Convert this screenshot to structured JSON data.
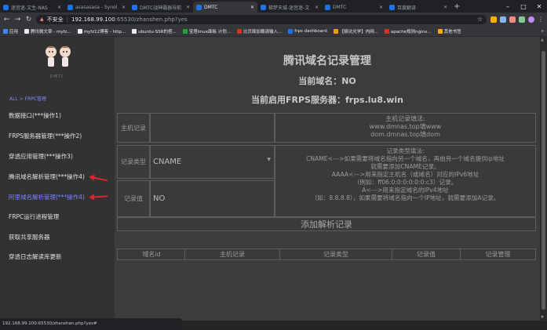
{
  "browser": {
    "tabs": [
      {
        "title": "迷宫迷-文生-NAS",
        "color": "#1a73e8",
        "active": false
      },
      {
        "title": "asasasasa - Synol",
        "color": "#1a73e8",
        "active": false
      },
      {
        "title": "DMTC战神霸器导航",
        "color": "#1a73e8",
        "active": false
      },
      {
        "title": "DMTC",
        "color": "#1a73e8",
        "active": true
      },
      {
        "title": "梯梦天城-迷宫迷-文",
        "color": "#1a73e8",
        "active": false
      },
      {
        "title": "DMTC",
        "color": "#1a73e8",
        "active": false
      },
      {
        "title": "百度翻译",
        "color": "#1a73e8",
        "active": false
      }
    ],
    "new_tab": "+",
    "window_controls": {
      "minimize": "–",
      "maximize": "□",
      "close": "✕"
    },
    "address": {
      "security": "不安全",
      "host": "192.168.99.100",
      "path": ":65530/zhanshen.php?yes"
    },
    "bookmarks": [
      {
        "label": "应用",
        "color": "#4285f4"
      },
      {
        "label": "腾讯微文章 - myfz...",
        "color": "#e8eaed"
      },
      {
        "label": "myfz12博客 - http...",
        "color": "#e8eaed"
      },
      {
        "label": "ubuntu-SSR的搭...",
        "color": "#e8eaed"
      },
      {
        "label": "宝塔linux面板 计划...",
        "color": "#20a53a"
      },
      {
        "label": "比页面加载请输入...",
        "color": "#d93025"
      },
      {
        "label": "frps dashboard",
        "color": "#1a73e8"
      },
      {
        "label": "【极坑光学】内网...",
        "color": "#f29900"
      },
      {
        "label": "apache规则nginx...",
        "color": "#d93025"
      },
      {
        "label": "其他书签",
        "color": "#f9ab00"
      }
    ],
    "bookmarks_more": "»",
    "status_url": "192.168.99.100:65530/zhanshen.php?yes#"
  },
  "sidebar": {
    "logo_text": "DMTC",
    "breadcrumb": "ALL  >  FRPC管理",
    "items": [
      {
        "label": "数据接口(***操作1)",
        "selected": false
      },
      {
        "label": "FRPS服务器管理(***操作2)",
        "selected": false
      },
      {
        "label": "穿透应用管理(***操作3)",
        "selected": false
      },
      {
        "label": "腾讯域名解析管理(***操作4)",
        "selected": false
      },
      {
        "label": "阿里域名解析管理(***操作4)",
        "selected": true
      },
      {
        "label": "FRPC运行进程管理",
        "selected": false
      },
      {
        "label": "获取共享服务器",
        "selected": false
      },
      {
        "label": "穿透日志解读库更新",
        "selected": false
      }
    ]
  },
  "main": {
    "title": "腾讯域名记录管理",
    "current_domain": "当前域名：NO",
    "current_frps": "当前启用FRPS服务器：frps.lu8.win",
    "form": {
      "host_label": "主机记录",
      "host_value": "",
      "host_help": [
        "主机记录填法:",
        "www.dmnas.top填www",
        "dom.dmnas.top填dom"
      ],
      "type_label": "记录类型",
      "type_value": "CNAME",
      "type_help": [
        "记录类型填法:",
        "CNAME<--->如果需要将域名指向另一个域名，再由另一个域名提供ip地址",
        "就需要添加CNAME记录。",
        "AAAA<--->用来指定主机名（或域名）对应的IPv6地址",
        "（例如：ff06:0:0:0:0:0:0:c3）记录。",
        "A<--->用来指定域名的IPv4地址",
        "（如：8.8.8.8），如果需要将域名指向一个IP地址，就需要添加A记录。"
      ],
      "value_label": "记录值",
      "value_value": "NO",
      "add_button": "添加解析记录"
    },
    "table_headers": [
      "域名id",
      "主机记录",
      "记录类型",
      "记录值",
      "记录管理"
    ]
  }
}
